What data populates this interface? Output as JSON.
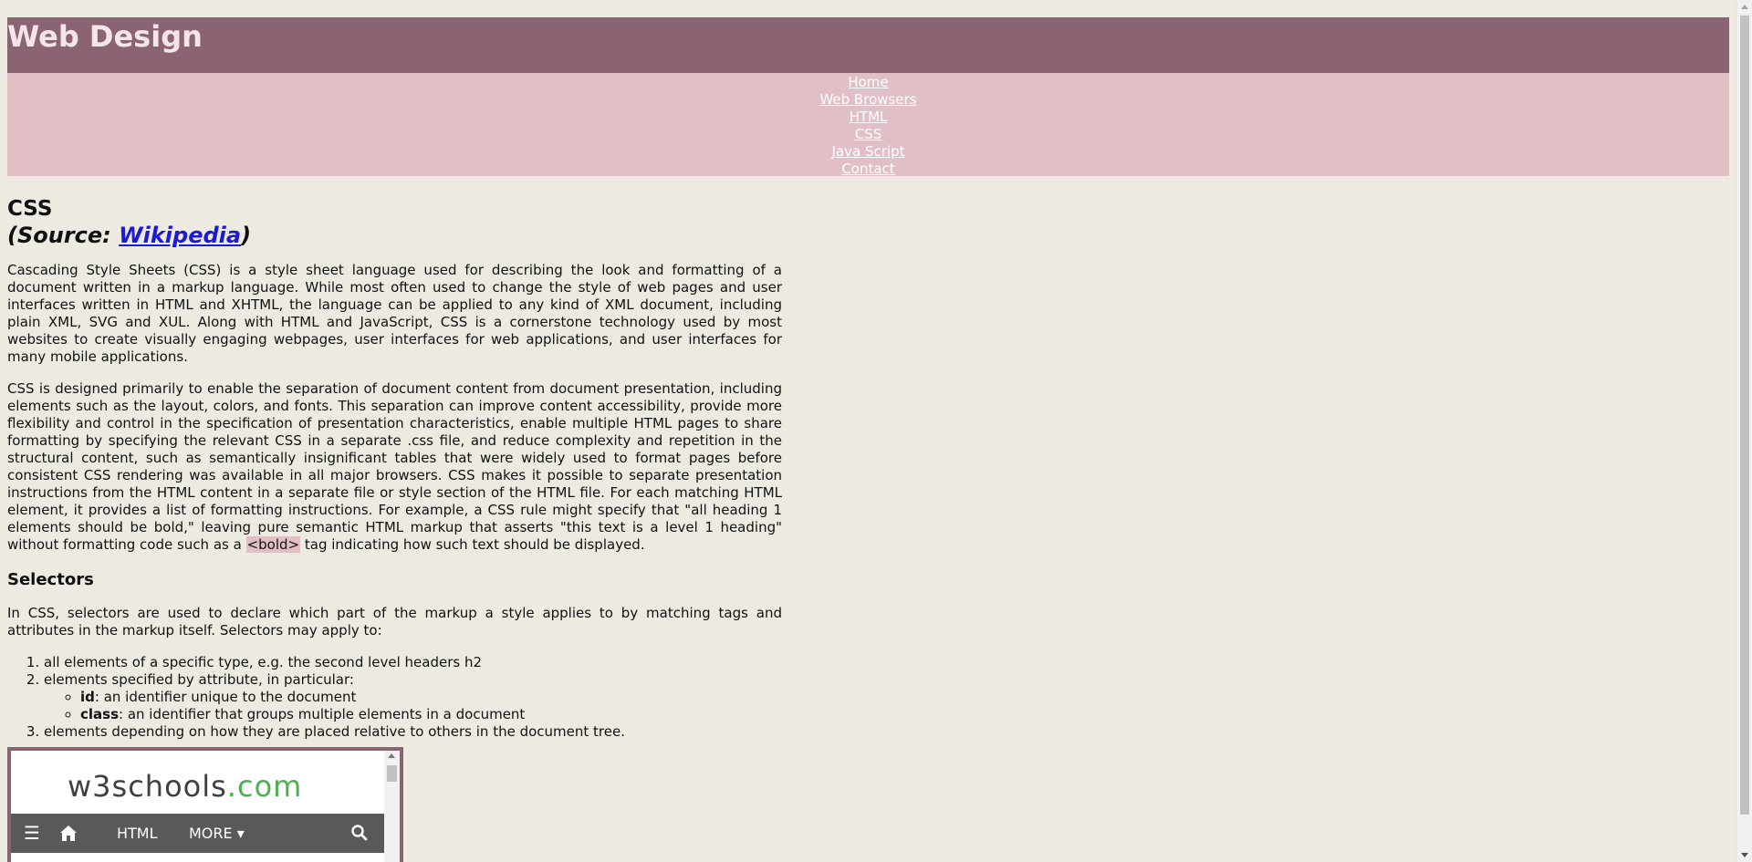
{
  "header": {
    "title": "Web Design"
  },
  "nav": {
    "items": [
      {
        "label": "Home"
      },
      {
        "label": "Web Browsers"
      },
      {
        "label": "HTML"
      },
      {
        "label": "CSS"
      },
      {
        "label": "Java Script"
      },
      {
        "label": "Contact"
      }
    ]
  },
  "article": {
    "title": "CSS",
    "source_prefix": "(Source: ",
    "source_link": "Wikipedia",
    "source_suffix": ")",
    "paragraph1": "Cascading Style Sheets (CSS) is a style sheet language used for describing the look and formatting of a document written in a markup language. While most often used to change the style of web pages and user interfaces written in HTML and XHTML, the language can be applied to any kind of XML document, including plain XML, SVG and XUL. Along with HTML and JavaScript, CSS is a cornerstone technology used by most websites to create visually engaging webpages, user interfaces for web applications, and user interfaces for many mobile applications.",
    "paragraph2_start": "CSS is designed primarily to enable the separation of document content from document presentation, including elements such as the layout, colors, and fonts. This separation can improve content accessibility, provide more flexibility and control in the specification of presentation characteristics, enable multiple HTML pages to share formatting by specifying the relevant CSS in a separate .css file, and reduce complexity and repetition in the structural content, such as semantically insignificant tables that were widely used to format pages before consistent CSS rendering was available in all major browsers. CSS makes it possible to separate presentation instructions from the HTML content in a separate file or style section of the HTML file. For each matching HTML element, it provides a list of formatting instructions. For example, a CSS rule might specify that \"all heading 1 elements should be bold,\" leaving pure semantic HTML markup that asserts \"this text is a level 1 heading\" without formatting code such as a ",
    "paragraph2_code": "<bold>",
    "paragraph2_end": " tag indicating how such text should be displayed.",
    "selectors_heading": "Selectors",
    "selectors_intro": "In CSS, selectors are used to declare which part of the markup a style applies to by matching tags and attributes in the markup itself. Selectors may apply to:",
    "list": {
      "item1": "all elements of a specific type, e.g. the second level headers h2",
      "item2": "elements specified by attribute, in particular:",
      "sub1_bold": "id",
      "sub1_text": ": an identifier unique to the document",
      "sub2_bold": "class",
      "sub2_text": ": an identifier that groups multiple elements in a document",
      "item3": "elements depending on how they are placed relative to others in the document tree."
    }
  },
  "embed": {
    "logo_main": "w3schools",
    "logo_tld": ".com",
    "nav": {
      "menu_icon": "☰",
      "home_icon": "home-icon",
      "html": "HTML",
      "more": "MORE ▾",
      "search_icon": "search-icon"
    }
  },
  "colors": {
    "page_bg": "#edeae2",
    "header_bg": "#8b6473",
    "nav_bg": "#e1bfc7",
    "link": "#1a1ad8",
    "w3_green": "#4caf50",
    "w3_nav_bg": "#595959"
  }
}
